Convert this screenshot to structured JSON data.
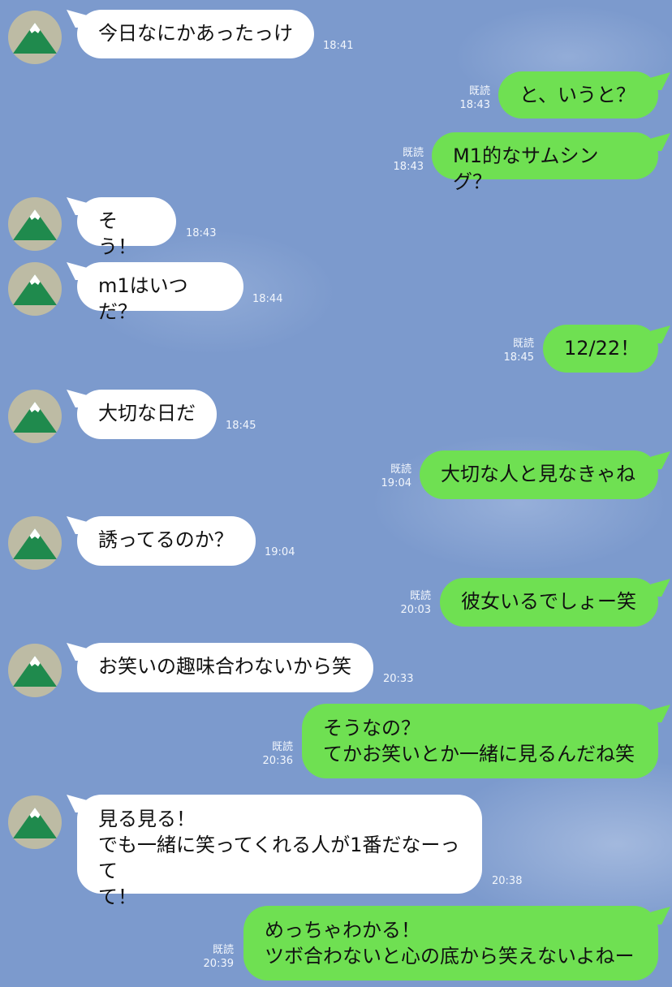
{
  "read_label": "既読",
  "messages": [
    {
      "text": "今日なにかあったっけ",
      "time": "18:41"
    },
    {
      "text": "と、いうと？",
      "time": "18:43"
    },
    {
      "text": "M1的なサムシング？",
      "time": "18:43"
    },
    {
      "text": "そう！",
      "time": "18:43"
    },
    {
      "text": "m1はいつだ？",
      "time": "18:44"
    },
    {
      "text": "12/22！",
      "time": "18:45"
    },
    {
      "text": "大切な日だ",
      "time": "18:45"
    },
    {
      "text": "大切な人と見なきゃね",
      "time": "19:04"
    },
    {
      "text": "誘ってるのか？",
      "time": "19:04"
    },
    {
      "text": "彼女いるでしょー笑",
      "time": "20:03"
    },
    {
      "text": "お笑いの趣味合わないから笑",
      "time": "20:33"
    },
    {
      "text": "そうなの？\nてかお笑いとか一緒に見るんだね笑",
      "time": "20:36"
    },
    {
      "text": "見る見る！\nでも一緒に笑ってくれる人が1番だなーって\nて！",
      "time": "20:38"
    },
    {
      "text": "めっちゃわかる！\nツボ合わないと心の底から笑えないよねー",
      "time": "20:39"
    }
  ]
}
